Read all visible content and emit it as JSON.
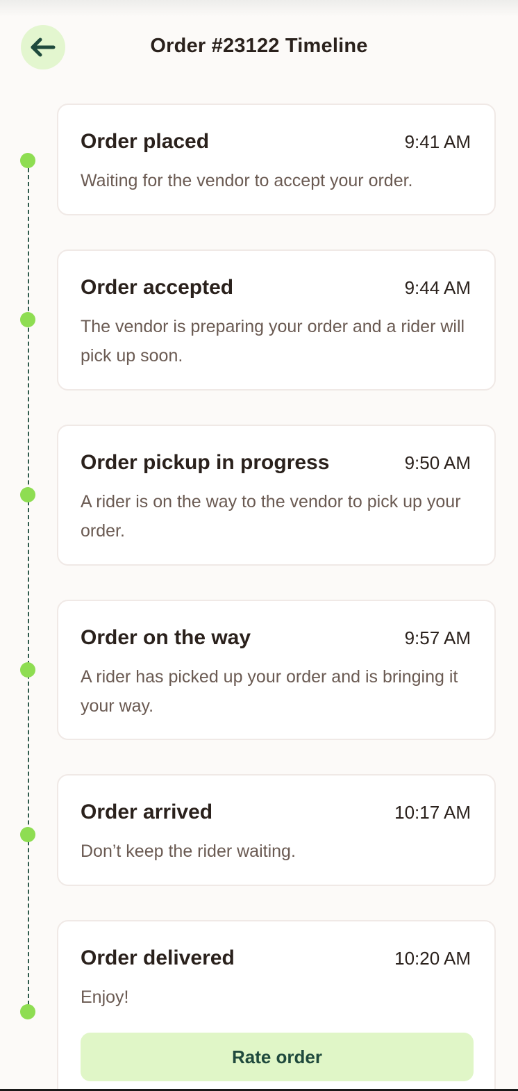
{
  "header": {
    "title": "Order #23122 Timeline",
    "back_icon": "arrow-left-icon"
  },
  "colors": {
    "accent_green": "#8edd52",
    "soft_green": "#e0f6c7",
    "dark_green": "#204a3d",
    "background": "#fcfaf8"
  },
  "timeline": [
    {
      "title": "Order placed",
      "time": "9:41 AM",
      "description": "Waiting for the vendor to accept your order."
    },
    {
      "title": "Order accepted",
      "time": "9:44 AM",
      "description": "The vendor is preparing your order and a rider will pick up soon."
    },
    {
      "title": "Order pickup in progress",
      "time": "9:50 AM",
      "description": "A rider is on the way to the vendor to pick up your order."
    },
    {
      "title": "Order on the way",
      "time": "9:57 AM",
      "description": "A rider has picked up your order and is bringing it your way."
    },
    {
      "title": "Order arrived",
      "time": "10:17 AM",
      "description": "Don’t keep the rider waiting."
    },
    {
      "title": "Order delivered",
      "time": "10:20 AM",
      "description": "Enjoy!"
    }
  ],
  "actions": {
    "rate_label": "Rate order"
  }
}
